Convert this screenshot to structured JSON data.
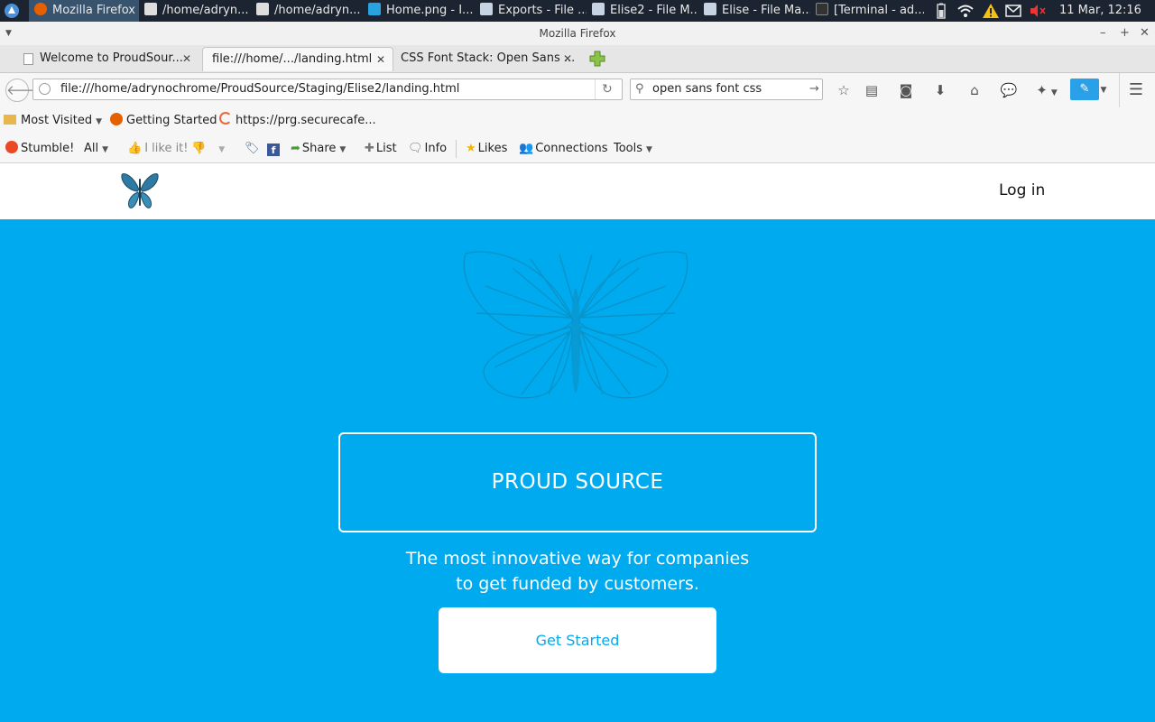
{
  "taskbar": {
    "items": [
      "Mozilla Firefox",
      "/home/adryn...",
      "/home/adryn...",
      "Home.png - I...",
      "Exports - File ...",
      "Elise2 - File M...",
      "Elise - File Ma...",
      "[Terminal - ad..."
    ],
    "clock": "11 Mar, 12:16"
  },
  "window": {
    "title": "Mozilla Firefox"
  },
  "tabs": [
    {
      "label": "Welcome to ProudSour...",
      "active": false
    },
    {
      "label": "file:///home/.../landing.html",
      "active": true
    },
    {
      "label": "CSS Font Stack: Open Sans ...",
      "active": false
    }
  ],
  "navbar": {
    "url": "file:///home/adrynochrome/ProudSource/Staging/Elise2/landing.html",
    "search_value": "open sans font css"
  },
  "bookmarks": [
    "Most Visited",
    "Getting Started",
    "https://prg.securecafe..."
  ],
  "stumble": {
    "stumble": "Stumble!",
    "all": "All",
    "like": "I like it!",
    "share": "Share",
    "list": "List",
    "info": "Info",
    "likes": "Likes",
    "connections": "Connections",
    "tools": "Tools"
  },
  "page": {
    "login": "Log in",
    "brand": "PROUD SOURCE",
    "tagline_line1": "The most innovative way for companies",
    "tagline_line2": "to get funded by customers.",
    "cta": "Get Started"
  },
  "colors": {
    "hero": "#00aaee",
    "cta_text": "#00aaee",
    "taskbar": "#1b2430"
  },
  "icons": [
    "firefox-icon",
    "butterfly-logo-icon",
    "butterfly-watermark-icon",
    "back-icon",
    "reload-icon",
    "search-icon",
    "star-icon",
    "home-icon",
    "menu-icon"
  ]
}
